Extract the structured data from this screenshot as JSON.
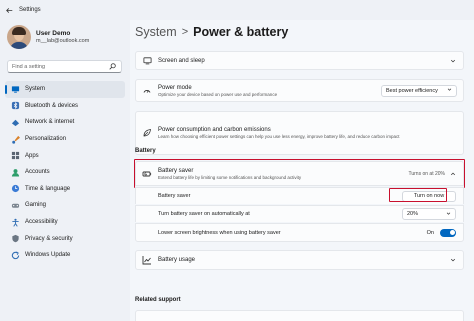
{
  "app": {
    "title": "Settings"
  },
  "user": {
    "name": "User Demo",
    "email": "m__lab@outlook.com"
  },
  "search": {
    "placeholder": "Find a setting"
  },
  "nav": [
    {
      "label": "System",
      "icon": "monitor-icon",
      "active": true
    },
    {
      "label": "Bluetooth & devices",
      "icon": "bluetooth-icon"
    },
    {
      "label": "Network & internet",
      "icon": "wifi-icon"
    },
    {
      "label": "Personalization",
      "icon": "brush-icon"
    },
    {
      "label": "Apps",
      "icon": "apps-icon"
    },
    {
      "label": "Accounts",
      "icon": "person-icon"
    },
    {
      "label": "Time & language",
      "icon": "globe-clock-icon"
    },
    {
      "label": "Gaming",
      "icon": "gamepad-icon"
    },
    {
      "label": "Accessibility",
      "icon": "accessibility-icon"
    },
    {
      "label": "Privacy & security",
      "icon": "shield-icon"
    },
    {
      "label": "Windows Update",
      "icon": "update-icon"
    }
  ],
  "breadcrumb": {
    "parent": "System",
    "separator": ">",
    "current": "Power & battery"
  },
  "cards": {
    "screen_sleep": {
      "title": "Screen and sleep"
    },
    "power_mode": {
      "title": "Power mode",
      "desc": "Optimize your device based on power use and performance",
      "value": "Best power efficiency"
    },
    "power_consumption": {
      "title": "Power consumption and carbon emissions",
      "desc": "Learn how choosing efficient power settings can help you use less energy, improve battery life, and reduce carbon impact"
    }
  },
  "battery_section": {
    "label": "Battery"
  },
  "battery_saver": {
    "title": "Battery saver",
    "desc": "Extend battery life by limiting some notifications and background activity",
    "status": "Turns on at 20%",
    "row_label": "Battery saver",
    "button_label": "Turn on now",
    "auto_label": "Turn battery saver on automatically at",
    "auto_value": "20%",
    "brightness_label": "Lower screen brightness when using battery saver",
    "brightness_state": "On"
  },
  "battery_usage": {
    "title": "Battery usage"
  },
  "related": {
    "label": "Related support"
  },
  "colors": {
    "accent": "#0067c0",
    "highlight": "#c8102e"
  }
}
